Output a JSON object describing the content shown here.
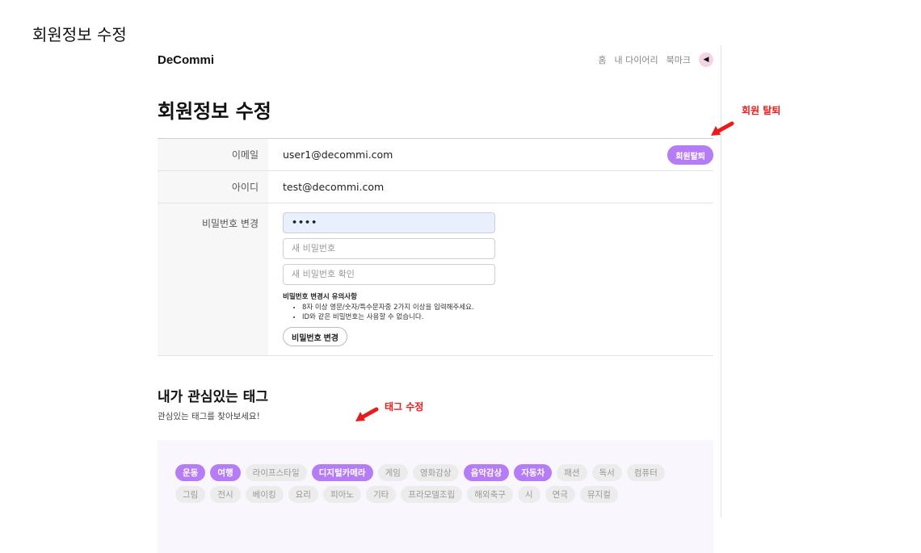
{
  "document_title": "회원정보 수정",
  "header": {
    "logo": "DeCommi",
    "nav": [
      "홈",
      "내 다이어리",
      "북마크"
    ]
  },
  "page_title": "회원정보 수정",
  "form": {
    "email_label": "이메일",
    "email_value": "user1@decommi.com",
    "withdraw_button": "회원탈퇴",
    "id_label": "아이디",
    "id_value": "test@decommi.com",
    "password_label": "비밀번호 변경",
    "current_password_value": "••••",
    "new_password_placeholder": "새 비밀번호",
    "confirm_password_placeholder": "새 비밀번호 확인",
    "notice_title": "비밀번호 변경시 유의사항",
    "notice_items": [
      "8자 이상 영문/숫자/특수문자중 2가지 이상을 입력해주세요.",
      "ID와 같은 비밀번호는 사용할 수 없습니다."
    ],
    "change_password_button": "비밀번호 변경"
  },
  "tags_section": {
    "title": "내가 관심있는 태그",
    "subtitle": "관심있는 태그를 찾아보세요!",
    "tags": [
      {
        "label": "운동",
        "selected": true
      },
      {
        "label": "여행",
        "selected": true
      },
      {
        "label": "라이프스타일",
        "selected": false
      },
      {
        "label": "디지털카메라",
        "selected": true
      },
      {
        "label": "게임",
        "selected": false
      },
      {
        "label": "영화감상",
        "selected": false
      },
      {
        "label": "음악감상",
        "selected": true
      },
      {
        "label": "자동차",
        "selected": true
      },
      {
        "label": "패션",
        "selected": false
      },
      {
        "label": "독서",
        "selected": false
      },
      {
        "label": "컴퓨터",
        "selected": false
      },
      {
        "label": "그림",
        "selected": false
      },
      {
        "label": "전시",
        "selected": false
      },
      {
        "label": "베이킹",
        "selected": false
      },
      {
        "label": "요리",
        "selected": false
      },
      {
        "label": "피아노",
        "selected": false
      },
      {
        "label": "기타",
        "selected": false
      },
      {
        "label": "프라모델조립",
        "selected": false
      },
      {
        "label": "해외축구",
        "selected": false
      },
      {
        "label": "시",
        "selected": false
      },
      {
        "label": "연극",
        "selected": false
      },
      {
        "label": "뮤지컬",
        "selected": false
      }
    ]
  },
  "annotations": {
    "withdraw_note": "회원 탈퇴",
    "tag_note": "태그 수정"
  },
  "colors": {
    "accent": "#b57cf5",
    "annotation": "#e81c1c"
  }
}
